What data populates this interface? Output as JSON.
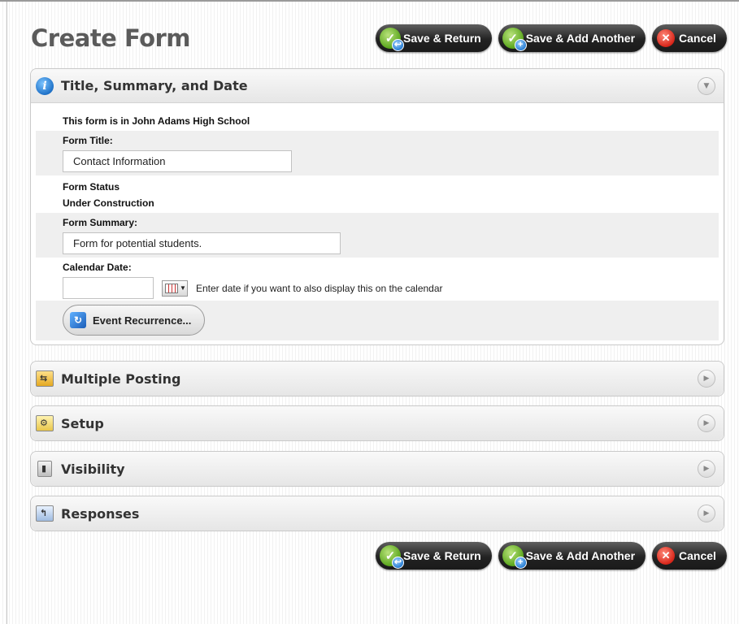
{
  "page_title": "Create Form",
  "buttons": {
    "save_return": "Save & Return",
    "save_add_another": "Save & Add Another",
    "cancel": "Cancel"
  },
  "sections": {
    "title_summary_date": {
      "heading": "Title, Summary, and Date",
      "school_notice": "This form is in John Adams High School",
      "form_title_label": "Form Title:",
      "form_title_value": "Contact Information",
      "form_status_label": "Form Status",
      "form_status_value": "Under Construction",
      "form_summary_label": "Form Summary:",
      "form_summary_value": "Form for potential students.",
      "calendar_date_label": "Calendar Date:",
      "calendar_date_value": "",
      "calendar_hint": "Enter date if you want to also display this on the calendar",
      "event_recurrence_label": "Event Recurrence..."
    },
    "multiple_posting": {
      "heading": "Multiple Posting"
    },
    "setup": {
      "heading": "Setup"
    },
    "visibility": {
      "heading": "Visibility"
    },
    "responses": {
      "heading": "Responses"
    }
  },
  "icons": {
    "info": "info-icon",
    "multiple_posting": "folders-icon",
    "setup": "setup-gear-icon",
    "visibility": "visibility-icon",
    "responses": "responses-icon",
    "collapse": "chevron-down-icon",
    "expand": "chevron-right-icon"
  }
}
